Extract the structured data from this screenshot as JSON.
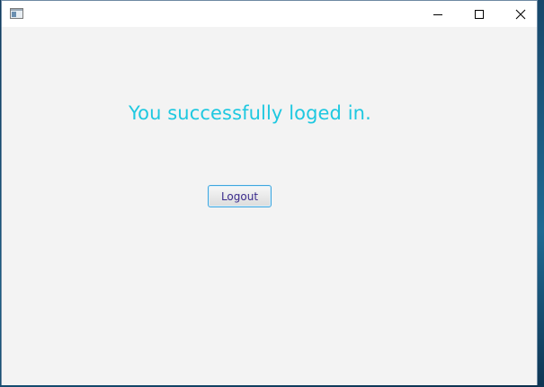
{
  "window": {
    "title": "",
    "icon": "java-app-window-icon",
    "controls": {
      "minimize_icon": "minimize-icon",
      "maximize_icon": "maximize-icon",
      "close_icon": "close-icon"
    }
  },
  "main": {
    "message": "You successfully loged in.",
    "logout_label": "Logout"
  },
  "colors": {
    "message": "#1ec8e0",
    "button_border": "#3fa6de",
    "button_text": "#3a2a8c",
    "window_bg": "#f3f3f3"
  }
}
